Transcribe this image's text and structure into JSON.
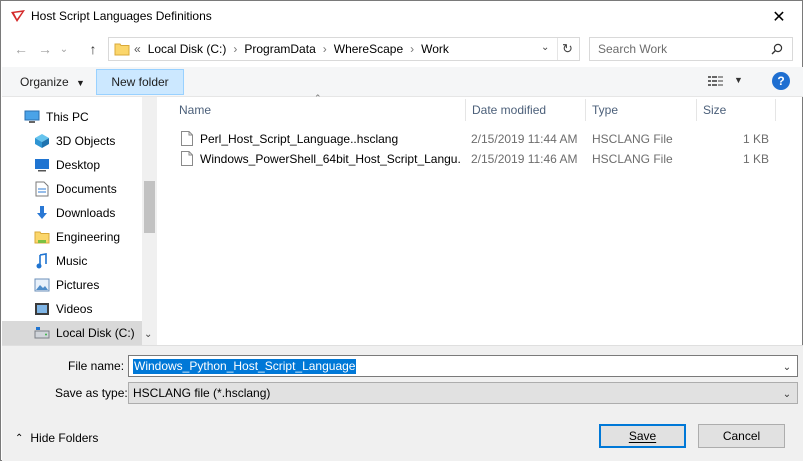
{
  "window": {
    "title": "Host Script Languages Definitions",
    "close_glyph": "✕"
  },
  "nav": {
    "back_glyph": "←",
    "forward_glyph": "→",
    "recent_glyph": "⌄",
    "up_glyph": "↑",
    "path_prefix": "«",
    "path": [
      "Local Disk (C:)",
      "ProgramData",
      "WhereScape",
      "Work"
    ],
    "path_sep": "›",
    "refresh_glyph": "↻",
    "search_placeholder": "Search Work"
  },
  "toolbar": {
    "organize_label": "Organize",
    "new_folder_label": "New folder",
    "help_label": "?"
  },
  "sidebar": {
    "items": [
      {
        "label": "This PC",
        "icon": "pc-icon"
      },
      {
        "label": "3D Objects",
        "icon": "cube-icon"
      },
      {
        "label": "Desktop",
        "icon": "desktop-icon"
      },
      {
        "label": "Documents",
        "icon": "documents-icon"
      },
      {
        "label": "Downloads",
        "icon": "download-icon"
      },
      {
        "label": "Engineering",
        "icon": "folder-icon"
      },
      {
        "label": "Music",
        "icon": "music-icon"
      },
      {
        "label": "Pictures",
        "icon": "pictures-icon"
      },
      {
        "label": "Videos",
        "icon": "videos-icon"
      },
      {
        "label": "Local Disk (C:)",
        "icon": "drive-icon",
        "selected": true
      }
    ]
  },
  "filelist": {
    "columns": {
      "name": "Name",
      "date": "Date modified",
      "type": "Type",
      "size": "Size"
    },
    "rows": [
      {
        "name": "Perl_Host_Script_Language..hsclang",
        "date": "2/15/2019 11:44 AM",
        "type": "HSCLANG File",
        "size": "1 KB"
      },
      {
        "name": "Windows_PowerShell_64bit_Host_Script_Langu...",
        "date": "2/15/2019 11:46 AM",
        "type": "HSCLANG File",
        "size": "1 KB"
      }
    ]
  },
  "bottom": {
    "file_name_label": "File name:",
    "file_name_value": "Windows_Python_Host_Script_Language",
    "save_type_label": "Save as type:",
    "save_type_value": "HSCLANG file (*.hsclang)",
    "hide_folders_label": "Hide Folders",
    "save_label": "Save",
    "cancel_label": "Cancel"
  },
  "colors": {
    "accent": "#0078d7",
    "selection": "#cce8ff",
    "header_text": "#4c607a"
  }
}
